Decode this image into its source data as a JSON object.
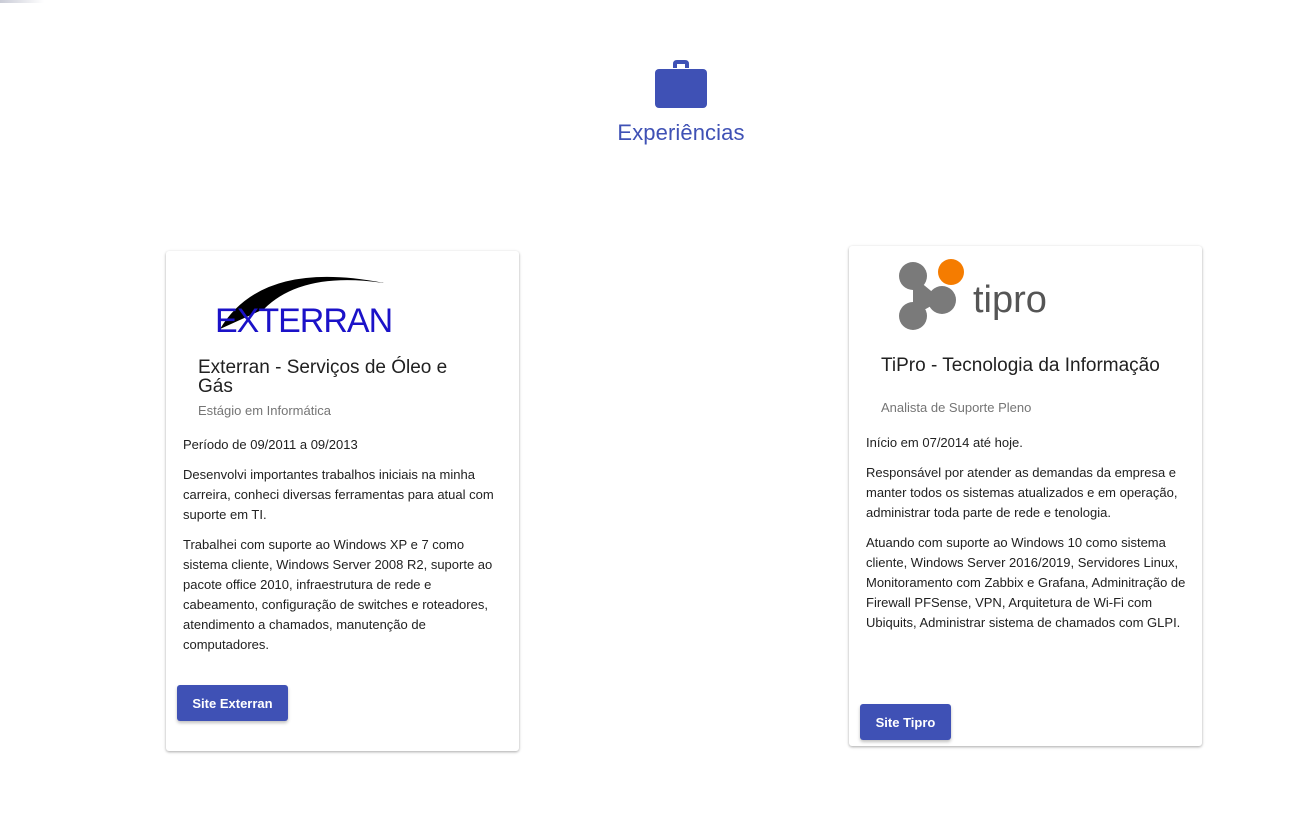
{
  "section": {
    "title": "Experiências",
    "icon": "briefcase-icon",
    "accent_color": "#3f51b5"
  },
  "experiences": [
    {
      "logo_text": "EXTERRAN",
      "title": "Exterran - Serviços de Óleo e Gás",
      "subtitle": "Estágio em Informática",
      "paragraphs": [
        "Período de 09/2011 a 09/2013",
        "Desenvolvi importantes trabalhos iniciais na minha carreira, conheci diversas ferramentas para atual com suporte em TI.",
        "Trabalhei com suporte ao Windows XP e 7 como sistema cliente, Windows Server 2008 R2, suporte ao pacote office 2010, infraestrutura de rede e cabeamento, configuração de switches e roteadores, atendimento a chamados, manutenção de computadores."
      ],
      "button_label": "Site Exterran"
    },
    {
      "logo_text": "tipro",
      "title": "TiPro - Tecnologia da Informação",
      "subtitle": "Analista de Suporte Pleno",
      "paragraphs": [
        "Início em 07/2014 até hoje.",
        "Responsável por atender as demandas da empresa e manter todos os sistemas atualizados e em operação, administrar toda parte de rede e tenologia.",
        "Atuando com suporte ao Windows 10 como sistema cliente, Windows Server 2016/2019, Servidores Linux, Monitoramento com Zabbix e Grafana, Adminitração de Firewall PFSense, VPN, Arquitetura de Wi-Fi com Ubiquits, Administrar sistema de chamados com GLPI."
      ],
      "button_label": "Site Tipro"
    }
  ]
}
